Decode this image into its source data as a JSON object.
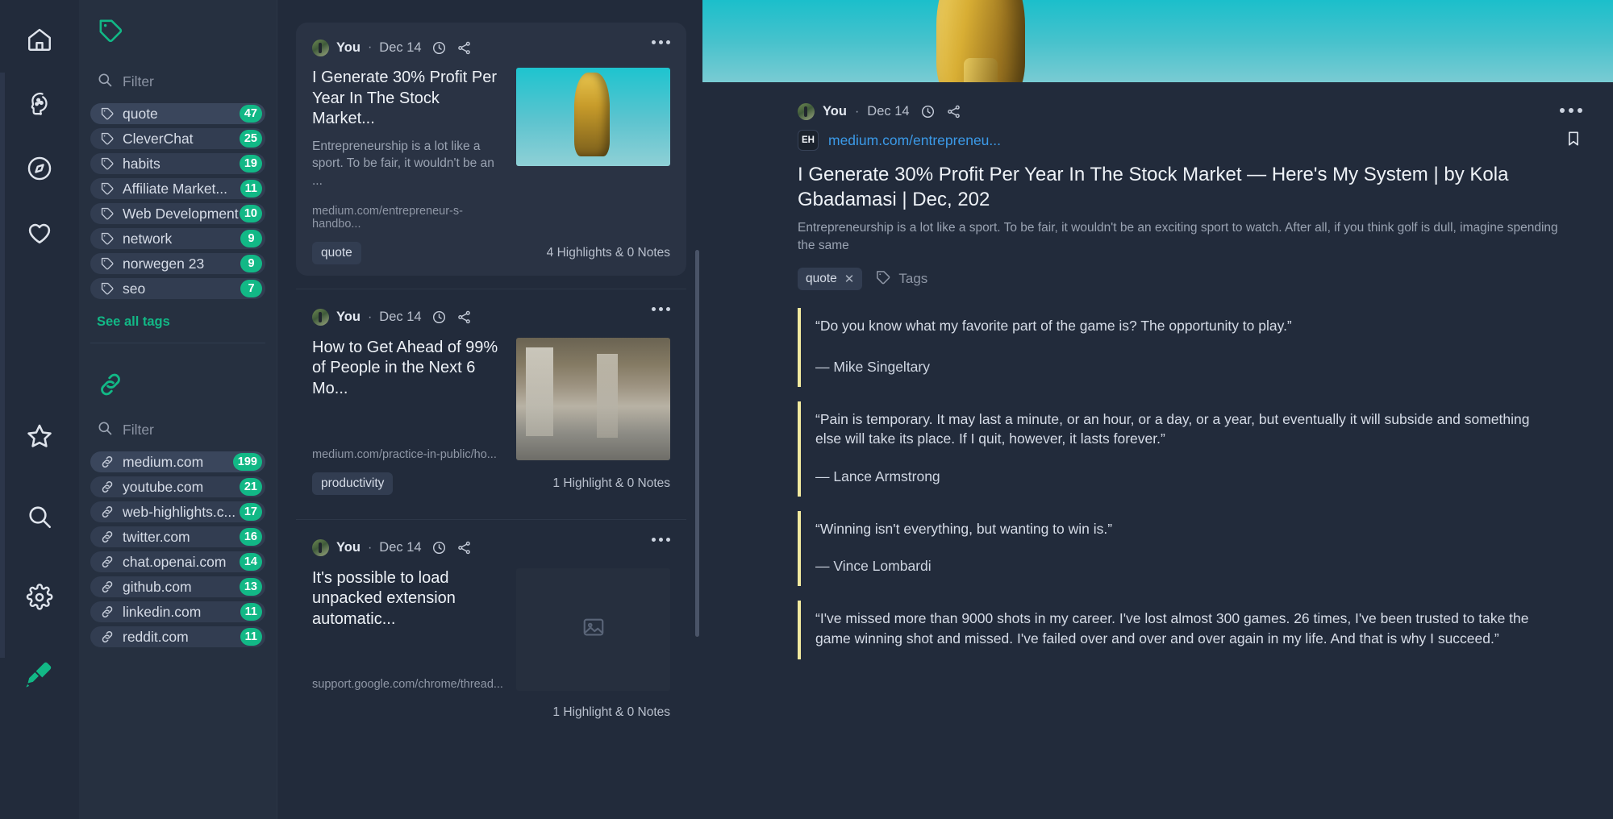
{
  "colors": {
    "accent": "#12b886",
    "link": "#3b9ae8",
    "quote_border": "#f2eaa0",
    "sidebar_bg": "#263040",
    "page_bg": "#222b3b",
    "card_bg": "#2a3344"
  },
  "rail": {
    "items": [
      {
        "name": "home-icon",
        "label": "Home"
      },
      {
        "name": "brain-idea-icon",
        "label": "Knowledge"
      },
      {
        "name": "compass-icon",
        "label": "Explore"
      },
      {
        "name": "heart-icon",
        "label": "Favorites"
      },
      {
        "name": "star-icon",
        "label": "Starred"
      },
      {
        "name": "search-icon",
        "label": "Search"
      },
      {
        "name": "gear-icon",
        "label": "Settings"
      },
      {
        "name": "highlighter-icon",
        "label": "Highlighter"
      }
    ]
  },
  "sidebar": {
    "tags_section": {
      "header_icon": "tag-icon",
      "filter_placeholder": "Filter",
      "filter_value": "",
      "see_all_label": "See all tags",
      "items": [
        {
          "label": "quote",
          "count": "47",
          "selected": true
        },
        {
          "label": "CleverChat",
          "count": "25",
          "selected": false
        },
        {
          "label": "habits",
          "count": "19",
          "selected": false
        },
        {
          "label": "Affiliate Market...",
          "count": "11",
          "selected": false
        },
        {
          "label": "Web Development",
          "count": "10",
          "selected": false
        },
        {
          "label": "network",
          "count": "9",
          "selected": false
        },
        {
          "label": "norwegen 23",
          "count": "9",
          "selected": false
        },
        {
          "label": "seo",
          "count": "7",
          "selected": false
        }
      ]
    },
    "links_section": {
      "header_icon": "link-icon",
      "filter_placeholder": "Filter",
      "filter_value": "",
      "items": [
        {
          "label": "medium.com",
          "count": "199",
          "selected": true
        },
        {
          "label": "youtube.com",
          "count": "21",
          "selected": false
        },
        {
          "label": "web-highlights.c...",
          "count": "17",
          "selected": false
        },
        {
          "label": "twitter.com",
          "count": "16",
          "selected": false
        },
        {
          "label": "chat.openai.com",
          "count": "14",
          "selected": false
        },
        {
          "label": "github.com",
          "count": "13",
          "selected": false
        },
        {
          "label": "linkedin.com",
          "count": "11",
          "selected": false
        },
        {
          "label": "reddit.com",
          "count": "11",
          "selected": false
        }
      ]
    }
  },
  "feed": {
    "cards": [
      {
        "author": "You",
        "separator": "·",
        "date": "Dec 14",
        "title": "I Generate 30% Profit Per Year In The Stock Market...",
        "description": "Entrepreneurship is a lot like a sport. To be fair, it wouldn't be an ...",
        "url": "medium.com/entrepreneur-s-handbo...",
        "tag": "quote",
        "stats": "4 Highlights & 0 Notes",
        "thumb": "trophy-image",
        "selected": true
      },
      {
        "author": "You",
        "separator": "·",
        "date": "Dec 14",
        "title": "How to Get Ahead of 99% of People in the Next 6 Mo...",
        "description": "",
        "url": "medium.com/practice-in-public/ho...",
        "tag": "productivity",
        "stats": "1 Highlight & 0 Notes",
        "thumb": "person-under-bridge-image",
        "selected": false
      },
      {
        "author": "You",
        "separator": "·",
        "date": "Dec 14",
        "title": "It's possible to load unpacked extension automatic...",
        "description": "",
        "url": "support.google.com/chrome/thread...",
        "tag": "",
        "stats": "1 Highlight & 0 Notes",
        "thumb": "image-placeholder-icon",
        "selected": false
      }
    ]
  },
  "detail": {
    "author": "You",
    "separator": "·",
    "date": "Dec 14",
    "favicon_text": "EH",
    "url": "medium.com/entrepreneu...",
    "title": "I Generate 30% Profit Per Year In The Stock Market — Here's My System | by Kola Gbadamasi | Dec, 202",
    "description": "Entrepreneurship is a lot like a sport. To be fair, it wouldn't be an exciting sport to watch. After all, if you think golf is dull, imagine spending the same",
    "tag_chip": "quote",
    "tag_chip_remove": "✕",
    "tags_add_label": "Tags",
    "bookmark_icon": "bookmark-icon",
    "highlights": [
      {
        "text": "“Do you know what my favorite part of the game is? The opportunity to play.”",
        "author": "— Mike Singeltary"
      },
      {
        "text": "“Pain is temporary. It may last a minute, or an hour, or a day, or a year, but eventually it will subside and something else will take its place. If I quit, however, it lasts forever.”",
        "author": "— Lance Armstrong"
      },
      {
        "text": "“Winning isn't everything, but wanting to win is.”",
        "author": "— Vince Lombardi"
      },
      {
        "text": "“I've missed more than 9000 shots in my career. I've lost almost 300 games. 26 times, I've been trusted to take the game winning shot and missed. I've failed over and over and over again in my life. And that is why I succeed.”",
        "author": ""
      }
    ]
  }
}
